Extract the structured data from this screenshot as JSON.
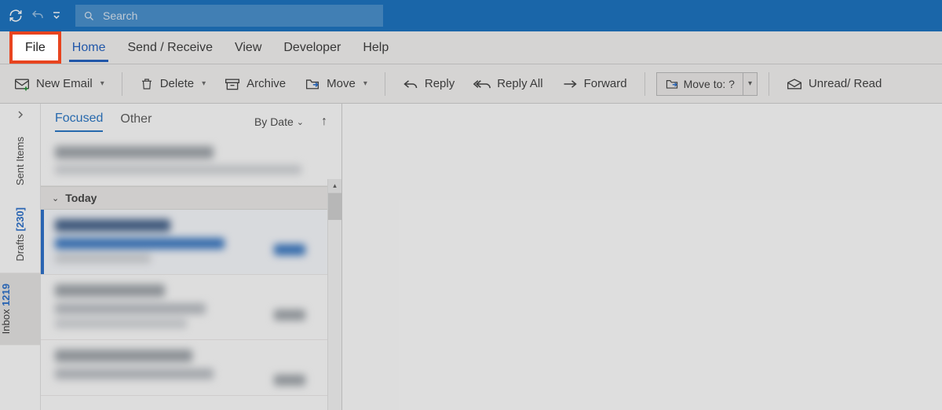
{
  "titlebar": {
    "search_placeholder": "Search"
  },
  "tabs": {
    "file": "File",
    "home": "Home",
    "send_receive": "Send / Receive",
    "view": "View",
    "developer": "Developer",
    "help": "Help"
  },
  "ribbon": {
    "new_email": "New Email",
    "delete": "Delete",
    "archive": "Archive",
    "move": "Move",
    "reply": "Reply",
    "reply_all": "Reply All",
    "forward": "Forward",
    "move_to_label": "Move to: ?",
    "unread_read": "Unread/ Read"
  },
  "nav": {
    "sent_items": "Sent Items",
    "drafts_label": "Drafts",
    "drafts_count": "[230]",
    "inbox_label": "Inbox",
    "inbox_count": "1219"
  },
  "list": {
    "focused": "Focused",
    "other": "Other",
    "sort_label": "By Date",
    "group_today": "Today"
  }
}
